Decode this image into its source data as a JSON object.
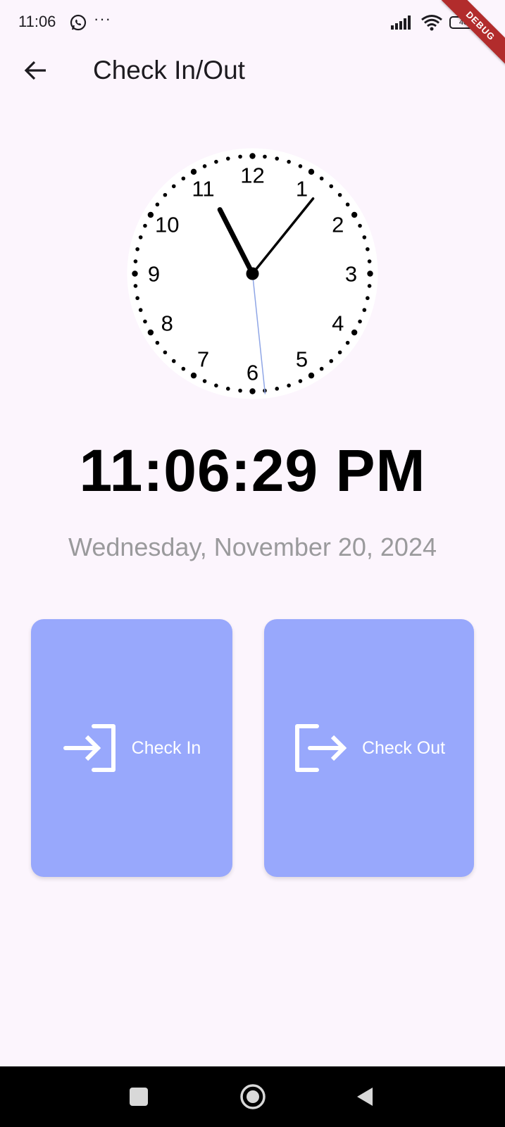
{
  "status_bar": {
    "time": "11:06",
    "more": "···",
    "battery": "46",
    "debug_label": "DEBUG"
  },
  "app_bar": {
    "title": "Check In/Out"
  },
  "clock": {
    "numbers": [
      "12",
      "1",
      "2",
      "3",
      "4",
      "5",
      "6",
      "7",
      "8",
      "9",
      "10",
      "11"
    ],
    "hour": 11,
    "minute": 6,
    "second": 29
  },
  "time_display": "11:06:29 PM",
  "date_display": "Wednesday, November 20, 2024",
  "actions": {
    "check_in_label": "Check In",
    "check_out_label": "Check Out"
  },
  "colors": {
    "background": "#fcf5fd",
    "card": "#98a8fc",
    "second_hand": "#8fa6e6"
  },
  "icons": {
    "back": "arrow-left-icon",
    "check_in": "login-icon",
    "check_out": "logout-icon"
  }
}
